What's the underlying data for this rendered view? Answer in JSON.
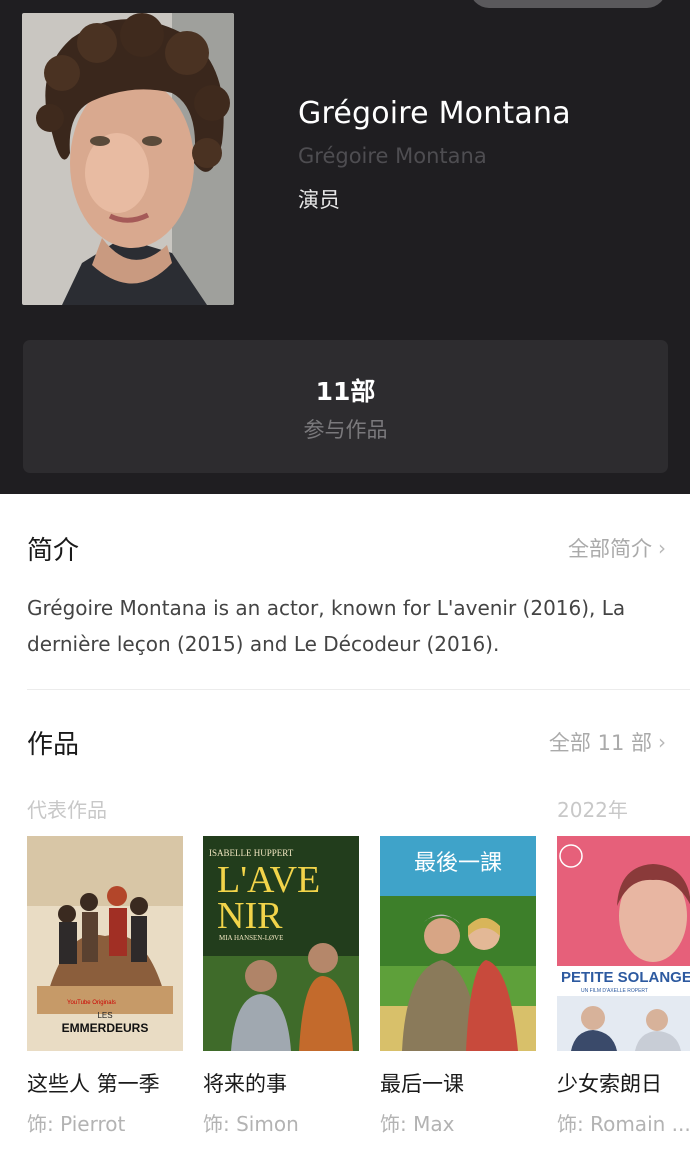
{
  "person": {
    "name": "Grégoire Montana",
    "original_name": "Grégoire Montana",
    "role": "演员"
  },
  "works_summary": {
    "count": "11部",
    "label": "参与作品"
  },
  "intro": {
    "title": "简介",
    "more": "全部简介",
    "text": "Grégoire Montana is an actor, known for L'avenir (2016), La dernière leçon (2015) and Le Décodeur (2016)."
  },
  "works": {
    "title": "作品",
    "more": "全部 11 部",
    "representative_label": "代表作品",
    "year_label": "2022年",
    "films": [
      {
        "title": "这些人 第一季",
        "role": "饰: Pierrot",
        "poster_text": [
          "YouTube Originals",
          "LES",
          "EMMERDEURS"
        ],
        "poster_colors": [
          "#e9dcc4",
          "#8b5e3c"
        ]
      },
      {
        "title": "将来的事",
        "role": "饰: Simon",
        "poster_text": [
          "ISABELLE HUPPERT",
          "L'AVE",
          "NIR",
          "MIA HANSEN-LØVE"
        ],
        "poster_colors": [
          "#2f5e22",
          "#f2d44a"
        ]
      },
      {
        "title": "最后一课",
        "role": "饰: Max",
        "poster_text": [
          "最後一課"
        ],
        "poster_colors": [
          "#4d8f2e",
          "#c84a3c"
        ]
      },
      {
        "title": "少女索朗日",
        "role": "饰: Romain ...",
        "poster_text": [
          "PETITE SOLANGE",
          "UN FILM D'AXELLE ROPERT"
        ],
        "poster_colors": [
          "#e6607a",
          "#2d5aa0"
        ]
      }
    ]
  },
  "colors": {
    "header_bg": "#1f1e21",
    "card_bg": "#2d2c2f",
    "muted_text": "#aaaaaa"
  }
}
